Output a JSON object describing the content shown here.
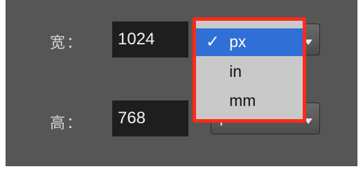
{
  "form": {
    "width_label": "宽：",
    "width_value": "1024",
    "height_label": "高：",
    "height_value": "768",
    "height_unit_visible": "p"
  },
  "unit_menu": {
    "items": [
      {
        "label": "px",
        "selected": true,
        "check": "✓"
      },
      {
        "label": "in",
        "selected": false
      },
      {
        "label": "mm",
        "selected": false
      }
    ]
  },
  "colors": {
    "panel_bg": "#565656",
    "highlight_border": "#ff2a1a",
    "selection": "#2f6fd6"
  }
}
